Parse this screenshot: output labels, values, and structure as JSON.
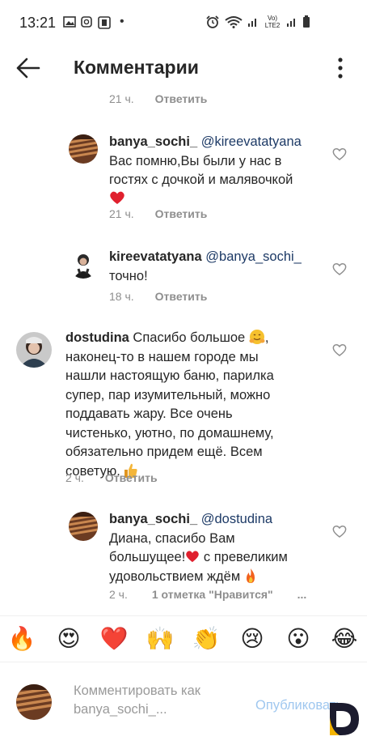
{
  "status_bar": {
    "time": "13:21",
    "dot": "•",
    "network_label": "Vo) LTE2"
  },
  "header": {
    "title": "Комментарии"
  },
  "comments": [
    {
      "meta_time": "21 ч.",
      "reply_label": "Ответить"
    },
    {
      "username": "banya_sochi_",
      "mention": "@kireevatatyana",
      "text_line1": "Вас помню,Вы были у нас в",
      "text_line2": "гостях с дочкой и малявочкой",
      "meta_time": "21 ч.",
      "reply_label": "Ответить"
    },
    {
      "username": "kireevatatyana",
      "mention": "@banya_sochi_",
      "text_line1": "точно!",
      "meta_time": "18 ч.",
      "reply_label": "Ответить"
    },
    {
      "username": "dostudina",
      "text_first": "Спасибо большое",
      "lines": [
        "наконец-то в нашем городе мы",
        "нашли настоящую баню, парилка",
        "супер, пар изумительный, можно",
        "поддавать жару. Все очень",
        "чистенько, уютно, по домашнему,",
        "обязательно придем ещё. Всем"
      ],
      "last_line": "советую.",
      "meta_time": "2 ч.",
      "reply_label": "Ответить"
    },
    {
      "username": "banya_sochi_",
      "mention": "@dostudina",
      "text_line1": "Диана, спасибо Вам",
      "text_line2a": "большущее!",
      "text_line2b": " с превеликим",
      "text_line3": "удовольствием ждём",
      "meta_time": "2 ч.",
      "likes_label": "1 отметка \"Нравится\"",
      "more": "..."
    }
  ],
  "emoji_bar": [
    "🔥",
    "😍",
    "❤️",
    "🙌",
    "👏",
    "😢",
    "😮",
    "😂"
  ],
  "composer": {
    "placeholder_line1": "Комментировать как",
    "placeholder_line2": "banya_sochi_...",
    "publish_label": "Опубликовать"
  },
  "colors": {
    "mention": "#1d3a66",
    "meta": "#8e8e8e",
    "publish": "#9fc7ef",
    "heart": "#e0202e"
  }
}
